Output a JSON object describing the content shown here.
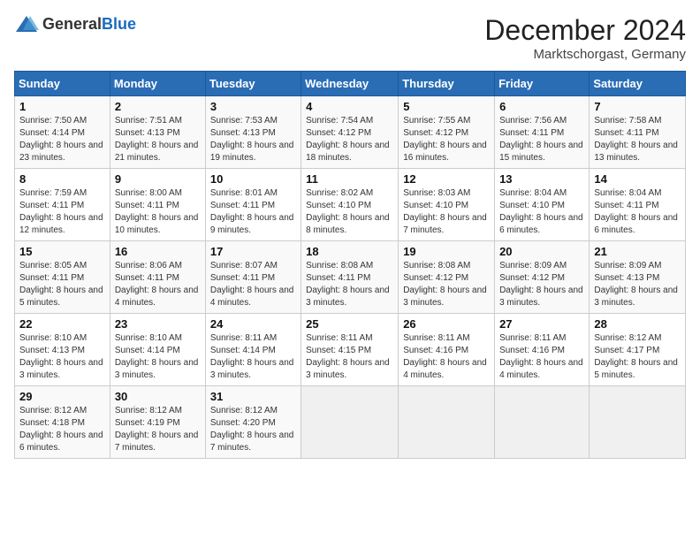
{
  "header": {
    "logo_general": "General",
    "logo_blue": "Blue",
    "month": "December 2024",
    "location": "Marktschorgast, Germany"
  },
  "days_of_week": [
    "Sunday",
    "Monday",
    "Tuesday",
    "Wednesday",
    "Thursday",
    "Friday",
    "Saturday"
  ],
  "weeks": [
    [
      {
        "day": 1,
        "sunrise": "7:50 AM",
        "sunset": "4:14 PM",
        "daylight": "8 hours and 23 minutes."
      },
      {
        "day": 2,
        "sunrise": "7:51 AM",
        "sunset": "4:13 PM",
        "daylight": "8 hours and 21 minutes."
      },
      {
        "day": 3,
        "sunrise": "7:53 AM",
        "sunset": "4:13 PM",
        "daylight": "8 hours and 19 minutes."
      },
      {
        "day": 4,
        "sunrise": "7:54 AM",
        "sunset": "4:12 PM",
        "daylight": "8 hours and 18 minutes."
      },
      {
        "day": 5,
        "sunrise": "7:55 AM",
        "sunset": "4:12 PM",
        "daylight": "8 hours and 16 minutes."
      },
      {
        "day": 6,
        "sunrise": "7:56 AM",
        "sunset": "4:11 PM",
        "daylight": "8 hours and 15 minutes."
      },
      {
        "day": 7,
        "sunrise": "7:58 AM",
        "sunset": "4:11 PM",
        "daylight": "8 hours and 13 minutes."
      }
    ],
    [
      {
        "day": 8,
        "sunrise": "7:59 AM",
        "sunset": "4:11 PM",
        "daylight": "8 hours and 12 minutes."
      },
      {
        "day": 9,
        "sunrise": "8:00 AM",
        "sunset": "4:11 PM",
        "daylight": "8 hours and 10 minutes."
      },
      {
        "day": 10,
        "sunrise": "8:01 AM",
        "sunset": "4:11 PM",
        "daylight": "8 hours and 9 minutes."
      },
      {
        "day": 11,
        "sunrise": "8:02 AM",
        "sunset": "4:10 PM",
        "daylight": "8 hours and 8 minutes."
      },
      {
        "day": 12,
        "sunrise": "8:03 AM",
        "sunset": "4:10 PM",
        "daylight": "8 hours and 7 minutes."
      },
      {
        "day": 13,
        "sunrise": "8:04 AM",
        "sunset": "4:10 PM",
        "daylight": "8 hours and 6 minutes."
      },
      {
        "day": 14,
        "sunrise": "8:04 AM",
        "sunset": "4:11 PM",
        "daylight": "8 hours and 6 minutes."
      }
    ],
    [
      {
        "day": 15,
        "sunrise": "8:05 AM",
        "sunset": "4:11 PM",
        "daylight": "8 hours and 5 minutes."
      },
      {
        "day": 16,
        "sunrise": "8:06 AM",
        "sunset": "4:11 PM",
        "daylight": "8 hours and 4 minutes."
      },
      {
        "day": 17,
        "sunrise": "8:07 AM",
        "sunset": "4:11 PM",
        "daylight": "8 hours and 4 minutes."
      },
      {
        "day": 18,
        "sunrise": "8:08 AM",
        "sunset": "4:11 PM",
        "daylight": "8 hours and 3 minutes."
      },
      {
        "day": 19,
        "sunrise": "8:08 AM",
        "sunset": "4:12 PM",
        "daylight": "8 hours and 3 minutes."
      },
      {
        "day": 20,
        "sunrise": "8:09 AM",
        "sunset": "4:12 PM",
        "daylight": "8 hours and 3 minutes."
      },
      {
        "day": 21,
        "sunrise": "8:09 AM",
        "sunset": "4:13 PM",
        "daylight": "8 hours and 3 minutes."
      }
    ],
    [
      {
        "day": 22,
        "sunrise": "8:10 AM",
        "sunset": "4:13 PM",
        "daylight": "8 hours and 3 minutes."
      },
      {
        "day": 23,
        "sunrise": "8:10 AM",
        "sunset": "4:14 PM",
        "daylight": "8 hours and 3 minutes."
      },
      {
        "day": 24,
        "sunrise": "8:11 AM",
        "sunset": "4:14 PM",
        "daylight": "8 hours and 3 minutes."
      },
      {
        "day": 25,
        "sunrise": "8:11 AM",
        "sunset": "4:15 PM",
        "daylight": "8 hours and 3 minutes."
      },
      {
        "day": 26,
        "sunrise": "8:11 AM",
        "sunset": "4:16 PM",
        "daylight": "8 hours and 4 minutes."
      },
      {
        "day": 27,
        "sunrise": "8:11 AM",
        "sunset": "4:16 PM",
        "daylight": "8 hours and 4 minutes."
      },
      {
        "day": 28,
        "sunrise": "8:12 AM",
        "sunset": "4:17 PM",
        "daylight": "8 hours and 5 minutes."
      }
    ],
    [
      {
        "day": 29,
        "sunrise": "8:12 AM",
        "sunset": "4:18 PM",
        "daylight": "8 hours and 6 minutes."
      },
      {
        "day": 30,
        "sunrise": "8:12 AM",
        "sunset": "4:19 PM",
        "daylight": "8 hours and 7 minutes."
      },
      {
        "day": 31,
        "sunrise": "8:12 AM",
        "sunset": "4:20 PM",
        "daylight": "8 hours and 7 minutes."
      },
      null,
      null,
      null,
      null
    ]
  ]
}
